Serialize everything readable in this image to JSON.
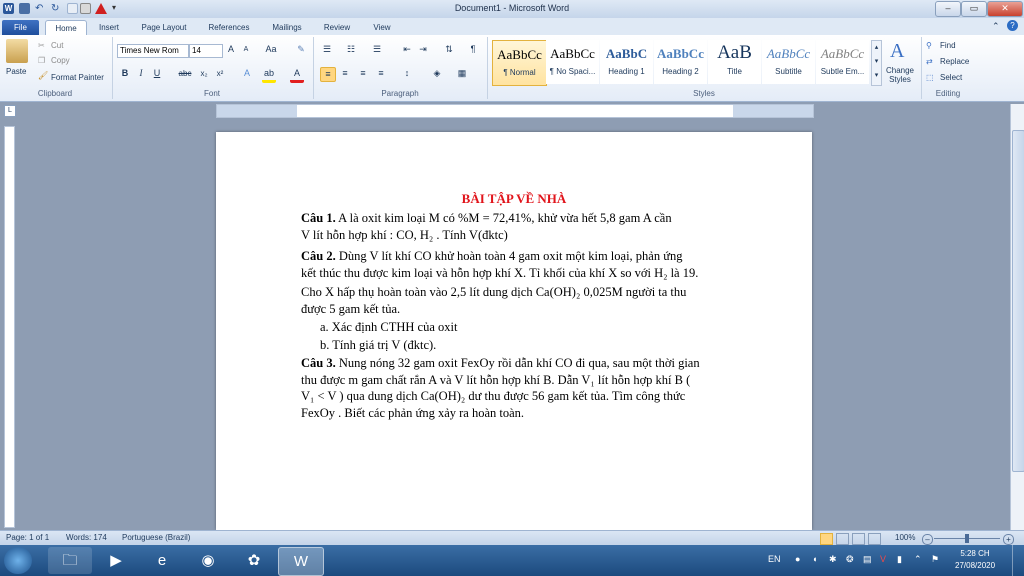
{
  "window": {
    "title": "Document1 - Microsoft Word",
    "minimize": "–",
    "maximize": "▭",
    "close": "✕"
  },
  "tabs": [
    "File",
    "Home",
    "Insert",
    "Page Layout",
    "References",
    "Mailings",
    "Review",
    "View"
  ],
  "ribbon": {
    "clipboard": {
      "paste": "Paste",
      "cut": "Cut",
      "copy": "Copy",
      "format_painter": "Format Painter",
      "label": "Clipboard"
    },
    "font": {
      "name": "Times New Rom",
      "size": "14",
      "label": "Font"
    },
    "paragraph": {
      "label": "Paragraph"
    },
    "styles": {
      "label": "Styles",
      "items": [
        {
          "sample": "AaBbCc",
          "name": "¶ Normal"
        },
        {
          "sample": "AaBbCc",
          "name": "¶ No Spaci..."
        },
        {
          "sample": "AaBbC",
          "name": "Heading 1"
        },
        {
          "sample": "AaBbCc",
          "name": "Heading 2"
        },
        {
          "sample": "AaB",
          "name": "Title"
        },
        {
          "sample": "AaBbCc",
          "name": "Subtitle"
        },
        {
          "sample": "AaBbCc",
          "name": "Subtle Em..."
        }
      ],
      "change_styles": "Change Styles"
    },
    "editing": {
      "find": "Find",
      "replace": "Replace",
      "select": "Select",
      "label": "Editing"
    }
  },
  "document": {
    "heading": "BÀI TẬP VỀ NHÀ",
    "lines": [
      {
        "b": "Câu 1.",
        "t": " A là oxit kim loại M có %M = 72,41%, khử vừa hết 5,8 gam A cần"
      },
      {
        "t": "V lít hỗn hợp khí : CO, H₂ . Tính V(đktc)"
      },
      {
        "b": "Câu 2.",
        "t": " Dùng V lít khí CO khử hoàn toàn 4 gam oxit một kim loại, phản ứng"
      },
      {
        "t": "kết thúc thu được kim loại và hỗn hợp khí X. Tỉ khối của khí X so với H₂ là 19."
      },
      {
        "t": "Cho X hấp thụ hoàn toàn vào 2,5 lít dung dịch Ca(OH)₂ 0,025M người ta thu"
      },
      {
        "t": "được 5 gam kết tủa."
      },
      {
        "t": "a.   Xác định CTHH của oxit"
      },
      {
        "t": "b.   Tính giá trị V (đktc)."
      },
      {
        "b": "Câu 3.",
        "t": " Nung nóng 32 gam oxit FexOy rồi dẫn khí CO đi qua, sau một thời gian"
      },
      {
        "t": "thu được m gam chất rắn A và V lít hỗn hợp khí B. Dẫn V₁ lít hỗn hợp khí B ("
      },
      {
        "t": "V₁ < V ) qua dung dịch Ca(OH)₂ dư thu được 56 gam kết tủa. Tìm công thức"
      },
      {
        "t": "FexOy . Biết các phản ứng xảy ra hoàn toàn."
      }
    ]
  },
  "status": {
    "page": "Page: 1 of 1",
    "words": "Words: 174",
    "language": "Portuguese (Brazil)",
    "zoom": "100%"
  },
  "taskbar": {
    "lang": "EN",
    "time": "5:28 CH",
    "date": "27/08/2020"
  }
}
